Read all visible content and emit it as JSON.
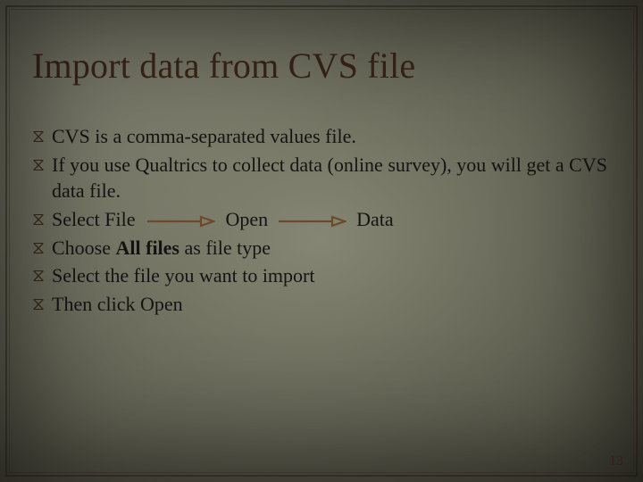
{
  "title": "Import data from CVS file",
  "bullets": {
    "b1": "CVS is a comma-separated values file.",
    "b2": "If you use Qualtrics to collect data (online survey), you will get a CVS data file.",
    "b3_pre": "Select File",
    "b3_mid": "Open",
    "b3_post": "Data",
    "b4_pre": "Choose ",
    "b4_bold": "All files ",
    "b4_post": "as file type",
    "b5": "Select the file you want to import",
    "b6": "Then click Open"
  },
  "page_number": "13",
  "icons": {
    "bullet_glyph": "⧖"
  }
}
